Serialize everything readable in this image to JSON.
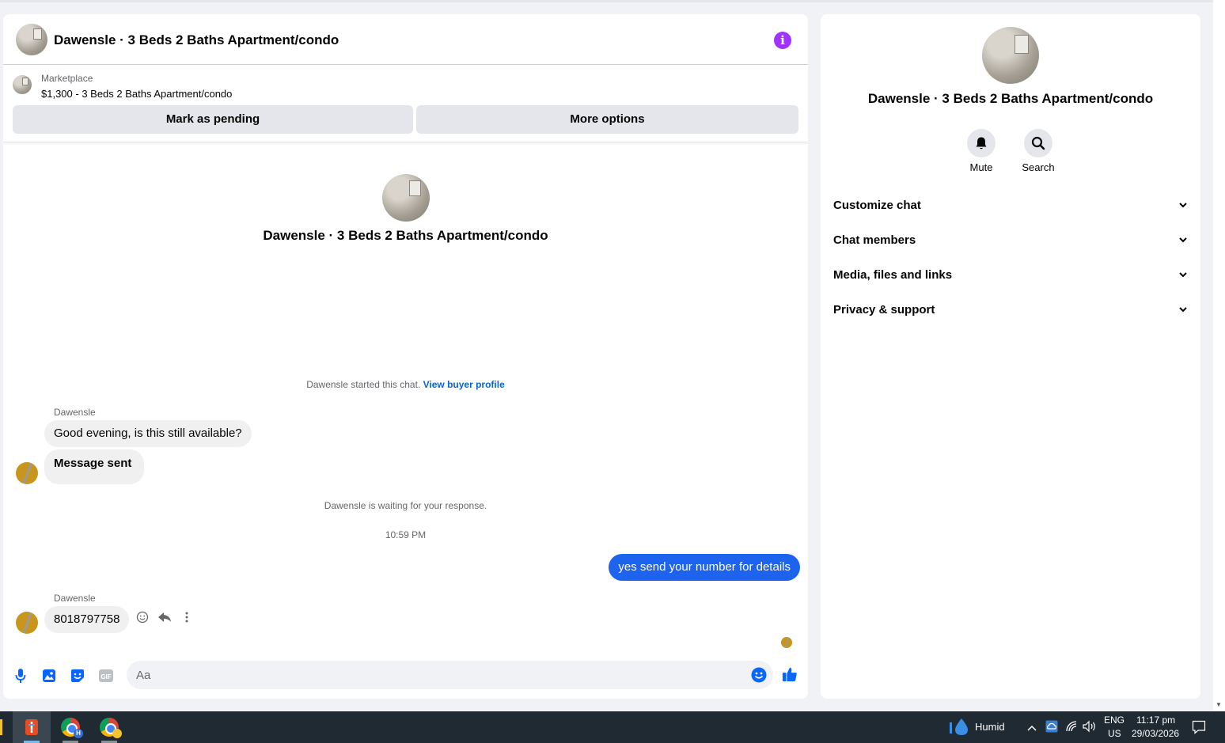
{
  "conversation": {
    "title": "Dawensle · 3 Beds 2 Baths Apartment/condo"
  },
  "listing": {
    "source": "Marketplace",
    "price_title": "$1,300 - 3 Beds 2 Baths Apartment/condo",
    "mark_pending_label": "Mark as pending",
    "more_options_label": "More options"
  },
  "messages": {
    "started_text": "Dawensle started this chat.",
    "view_buyer_profile": "View buyer profile",
    "sender_1": "Dawensle",
    "msg_1": "Good evening, is this still available?",
    "msg_2": "Message sent",
    "waiting_text": "Dawensle is waiting for your response.",
    "timestamp": "10:59 PM",
    "msg_out": "yes send your number for details",
    "sender_2": "Dawensle",
    "msg_3": "8018797758"
  },
  "composer": {
    "placeholder": "Aa"
  },
  "sidebar": {
    "title": "Dawensle · 3 Beds 2 Baths Apartment/condo",
    "mute_label": "Mute",
    "search_label": "Search",
    "sections": [
      "Customize chat",
      "Chat members",
      "Media, files and links",
      "Privacy & support"
    ]
  },
  "taskbar": {
    "weather": "Humid",
    "lang_1": "ENG",
    "lang_2": "US",
    "time": "11:17 pm",
    "date": "29/03/2026",
    "chrome_badge": "H"
  },
  "colors": {
    "accent_blue": "#1d63ed",
    "info_purple": "#a033ff",
    "link_blue": "#0a65d1"
  }
}
